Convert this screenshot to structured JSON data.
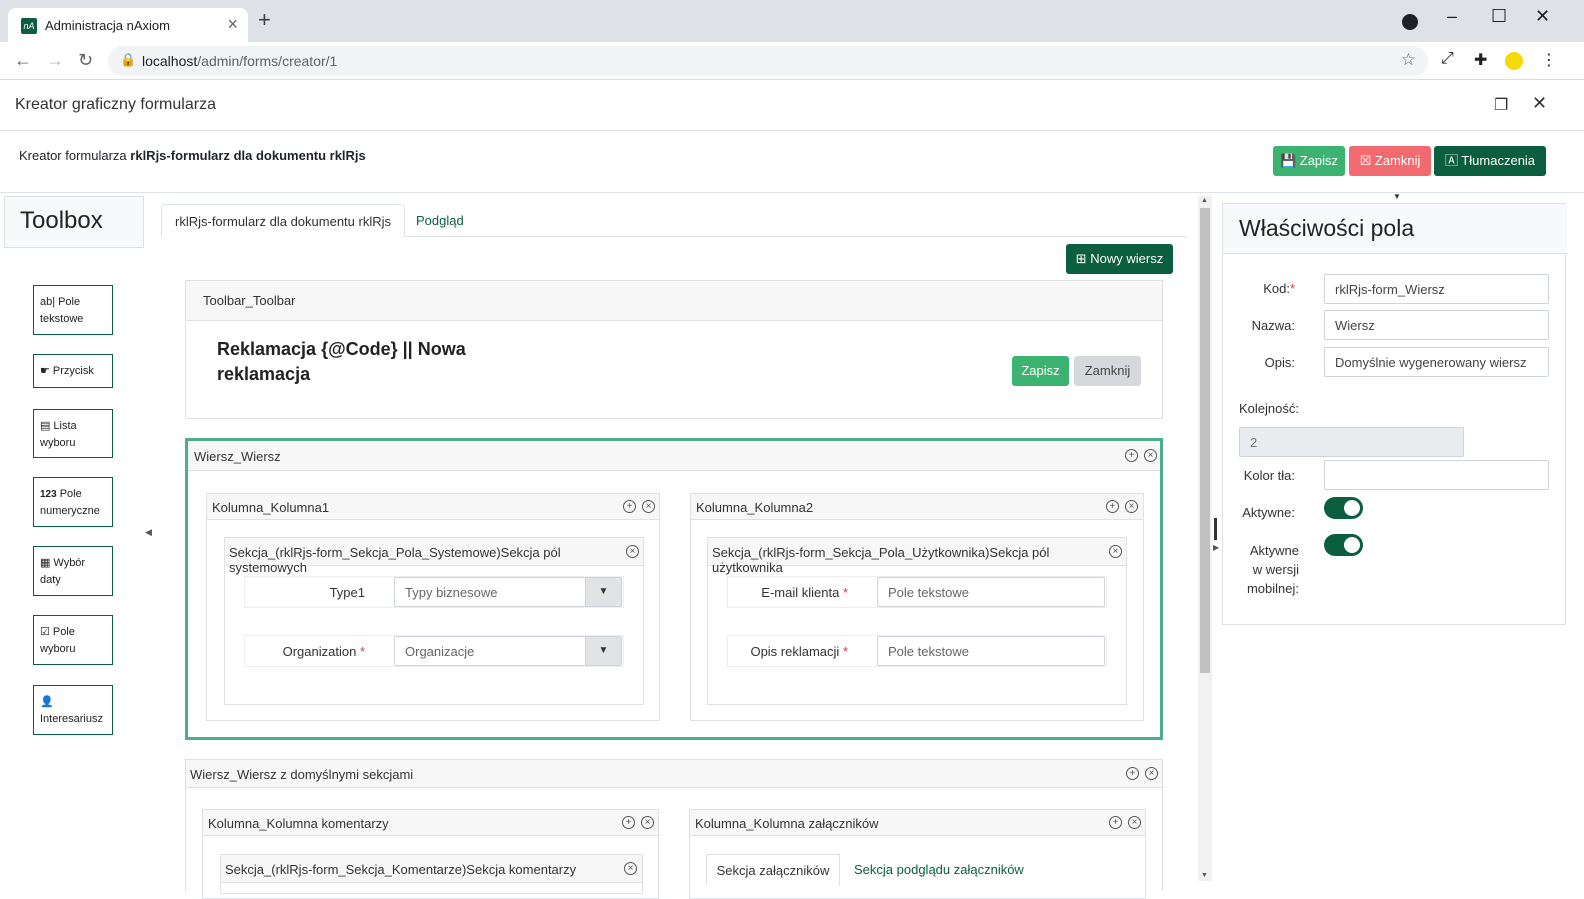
{
  "browser": {
    "tab_title": "Administracja nAxiom",
    "favicon_text": "nA",
    "url_host": "localhost",
    "url_path": "/admin/forms/creator/1"
  },
  "dialog": {
    "title": "Kreator graficzny formularza",
    "subtitle_prefix": "Kreator formularza",
    "subtitle_bold": "rklRjs-formularz dla dokumentu rklRjs",
    "buttons": {
      "save": "Zapisz",
      "close": "Zamknij",
      "translations": "Tłumaczenia"
    }
  },
  "toolbox": {
    "title": "Toolbox",
    "items": [
      {
        "icon": "ab|",
        "label": "Pole tekstowe"
      },
      {
        "icon": "☛",
        "label": "Przycisk"
      },
      {
        "icon": "▤",
        "label": "Lista wyboru"
      },
      {
        "icon": "123",
        "label": "Pole numeryczne"
      },
      {
        "icon": "▦",
        "label": "Wybór daty"
      },
      {
        "icon": "☑",
        "label": "Pole wyboru"
      },
      {
        "icon": "👤",
        "label": "Interesariusz"
      }
    ]
  },
  "tabs": [
    "rklRjs-formularz dla dokumentu rklRjs",
    "Podgląd"
  ],
  "new_row_button": "Nowy wiersz",
  "toolbar_panel": {
    "header": "Toolbar_Toolbar",
    "title_line1": "Reklamacja {@Code} || Nowa",
    "title_line2": "reklamacja",
    "save": "Zapisz",
    "close": "Zamknij"
  },
  "row1": {
    "header": "Wiersz_Wiersz",
    "col1": {
      "header": "Kolumna_Kolumna1",
      "section": "Sekcja_(rklRjs-form_Sekcja_Pola_Systemowe)Sekcja pól systemowych",
      "fields": [
        {
          "label": "Type1",
          "required": false,
          "placeholder": "Typy biznesowe"
        },
        {
          "label": "Organization",
          "required": true,
          "placeholder": "Organizacje"
        }
      ]
    },
    "col2": {
      "header": "Kolumna_Kolumna2",
      "section": "Sekcja_(rklRjs-form_Sekcja_Pola_Użytkownika)Sekcja pól użytkownika",
      "fields": [
        {
          "label": "E-mail klienta",
          "required": true,
          "placeholder": "Pole tekstowe"
        },
        {
          "label": "Opis reklamacji",
          "required": true,
          "placeholder": "Pole tekstowe"
        }
      ]
    }
  },
  "row2": {
    "header": "Wiersz_Wiersz z domyślnymi sekcjami",
    "col1": {
      "header": "Kolumna_Kolumna komentarzy",
      "section": "Sekcja_(rklRjs-form_Sekcja_Komentarze)Sekcja komentarzy"
    },
    "col2": {
      "header": "Kolumna_Kolumna załączników",
      "tab_active": "Sekcja załączników",
      "tab_link": "Sekcja podglądu załączników"
    }
  },
  "properties": {
    "title": "Właściwości pola",
    "code_label": "Kod:",
    "code_value": "rklRjs-form_Wiersz",
    "name_label": "Nazwa:",
    "name_value": "Wiersz",
    "desc_label": "Opis:",
    "desc_value": "Domyślnie wygenerowany wiersz",
    "order_label": "Kolejność:",
    "order_value": "2",
    "bg_label": "Kolor tła:",
    "active_label": "Aktywne:",
    "active_mobile_label": "Aktywne w wersji mobilnej:",
    "active": true,
    "active_mobile": true
  },
  "colors": {
    "primary": "#0b5e3f",
    "success": "#3cb371",
    "danger": "#f06a70",
    "highlight_border": "#4caf8a"
  }
}
